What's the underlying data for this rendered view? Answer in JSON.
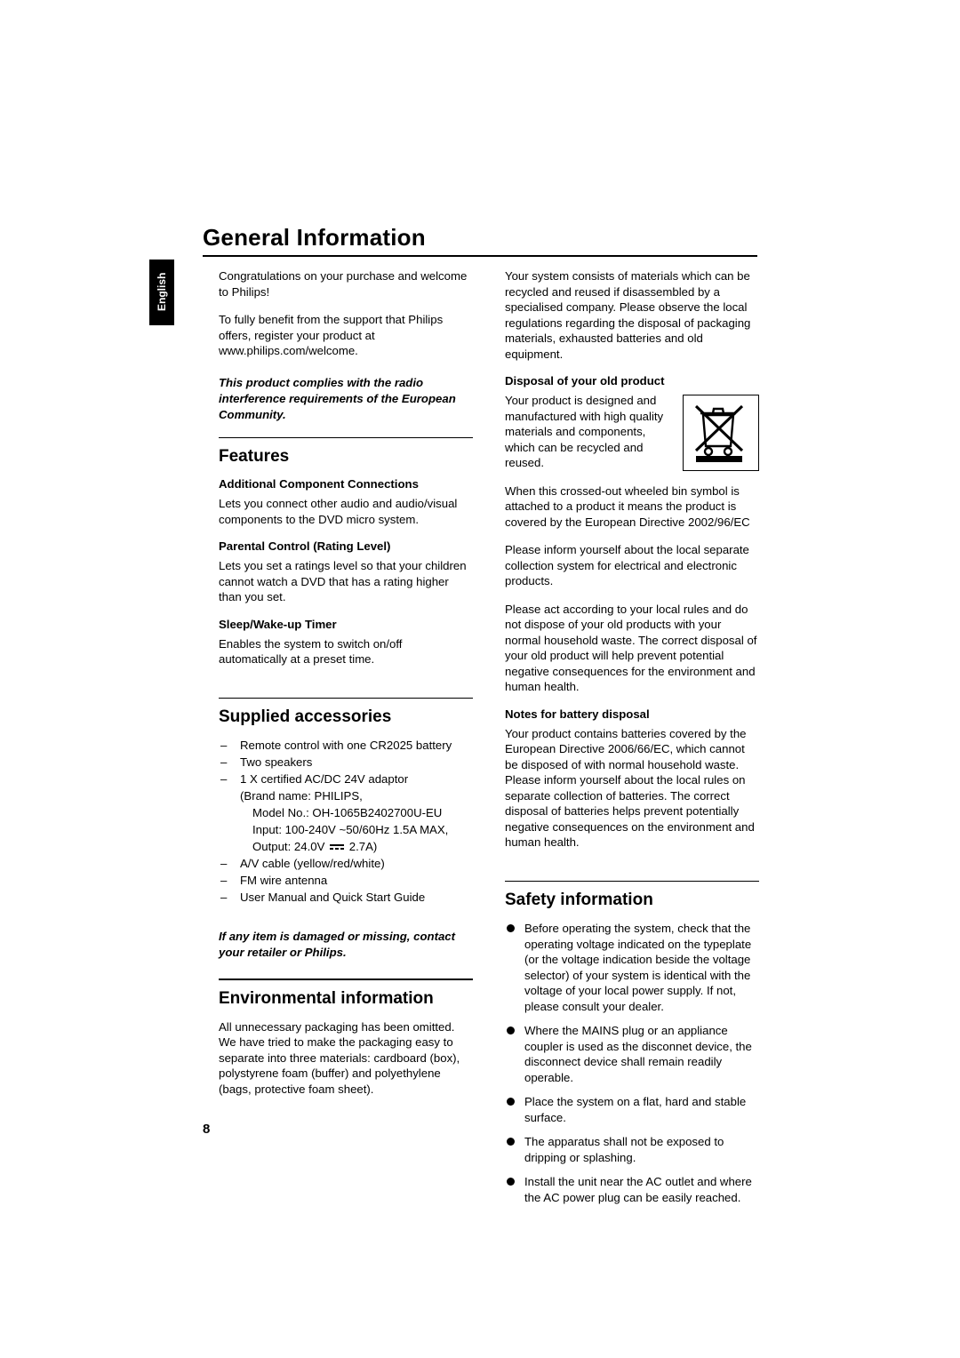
{
  "page": {
    "title": "General Information",
    "side_tab": "English",
    "page_number": "8"
  },
  "left_column": {
    "intro_1": "Congratulations on your purchase and welcome to Philips!",
    "intro_2": "To fully benefit from the support that Philips offers, register your product at www.philips.com/welcome.",
    "compliance_note": "This product complies with the radio interference requirements of the European Community.",
    "features_heading": "Features",
    "features": [
      {
        "title": "Additional Component Connections",
        "body": "Lets you connect other audio and audio/visual components to the DVD micro system."
      },
      {
        "title": "Parental Control (Rating Level)",
        "body": "Lets you set a ratings level so that your children cannot watch a DVD that has a rating higher than you set."
      },
      {
        "title": "Sleep/Wake-up Timer",
        "body": "Enables the system to switch on/off automatically at a preset time."
      }
    ],
    "accessories_heading": "Supplied accessories",
    "accessories": [
      "Remote control with one CR2025 battery",
      "Two speakers",
      "1 X certified AC/DC 24V adaptor",
      "A/V cable (yellow/red/white)",
      "FM wire antenna",
      "User Manual and Quick Start Guide"
    ],
    "adaptor_detail_1": "(Brand name: PHILIPS,",
    "adaptor_detail_2": "Model No.: OH-1065B2402700U-EU",
    "adaptor_detail_3": "Input: 100-240V ~50/60Hz 1.5A MAX,",
    "adaptor_detail_4_pre": "Output: 24.0V",
    "adaptor_detail_4_post": "2.7A)",
    "damaged_note": "If any item is damaged or missing, contact your retailer or Philips.",
    "environmental_heading": "Environmental information",
    "environmental_body": "All unnecessary packaging has been omitted. We have tried to make the packaging easy to separate into three materials: cardboard (box), polystyrene foam (buffer) and polyethylene (bags, protective foam sheet)."
  },
  "right_column": {
    "recycle_intro": "Your system consists of materials which can be recycled and reused if disassembled by a specialised company. Please observe the local regulations regarding the disposal of packaging materials, exhausted batteries and old equipment.",
    "disposal_heading": "Disposal of  your old product",
    "disposal_p1": "Your product is designed and manufactured with high quality materials and components, which can be recycled and reused.",
    "disposal_p2": "When this crossed-out wheeled bin symbol is attached to a product it means the product is covered by the European Directive 2002/96/EC",
    "disposal_p3": "Please inform yourself about the local separate collection system for electrical and electronic products.",
    "disposal_p4": "Please act according to your local rules and do not dispose of your old products with your normal household waste. The correct disposal of your old product will help prevent potential negative consequences for the environment and human health.",
    "battery_heading": "Notes for battery disposal",
    "battery_body": "Your product contains batteries covered by the European Directive 2006/66/EC, which cannot be disposed of with normal household waste. Please inform yourself about the local rules on separate collection of batteries. The correct disposal of batteries helps prevent potentially negative consequences on the environment and human health.",
    "safety_heading": "Safety information",
    "safety_items": [
      "Before operating the system, check that the operating voltage indicated on the typeplate (or the voltage indication beside the voltage selector) of your system is identical with the voltage of your local power supply. If not, please consult your dealer.",
      "Where the MAINS plug or an appliance coupler is used as the disconnet device, the disconnect device shall remain readily operable.",
      "Place the system on a flat, hard and stable surface.",
      "The apparatus shall not be exposed to dripping or splashing.",
      "Install the unit near the AC outlet and where the AC power plug can be easily reached."
    ],
    "weee_icon": "crossed-out-wheeled-bin-icon"
  }
}
